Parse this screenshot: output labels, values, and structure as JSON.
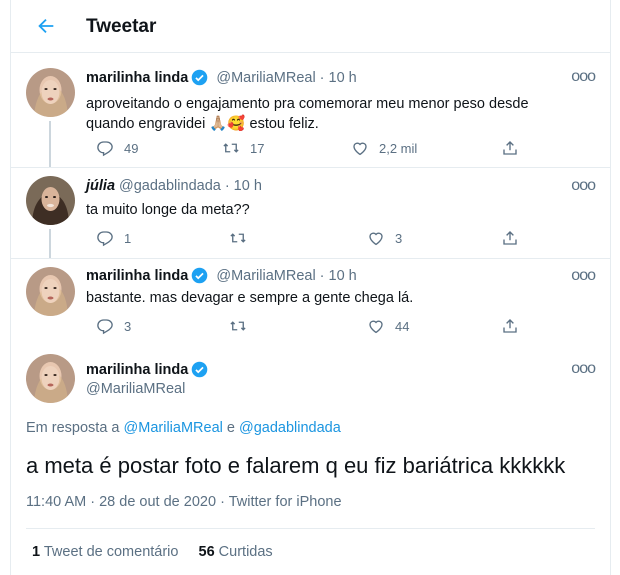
{
  "header": {
    "title": "Tweetar"
  },
  "tweets": [
    {
      "name": "marilinha linda",
      "handle": "@MariliaMReal",
      "time": "10 h",
      "text_line1": "aproveitando o engajamento pra comemorar meu menor peso desde",
      "text_line2_a": "quando engravidei",
      "emoji": "🙏🏼🥰",
      "text_line2_b": "estou feliz.",
      "replies": "49",
      "retweets": "17",
      "likes": "2,2 mil"
    },
    {
      "name": "júlia",
      "handle": "@gadablindada",
      "time": "10 h",
      "text": "ta muito longe da meta??",
      "replies": "1",
      "retweets": "",
      "likes": "3"
    },
    {
      "name": "marilinha linda",
      "handle": "@MariliaMReal",
      "time": "10 h",
      "text": "bastante. mas devagar e sempre a gente chega lá.",
      "replies": "3",
      "retweets": "",
      "likes": "44"
    }
  ],
  "main": {
    "name": "marilinha linda",
    "handle": "@MariliaMReal",
    "reply_prefix": "Em resposta a",
    "reply_user1": "@MariliaMReal",
    "reply_and": "e",
    "reply_user2": "@gadablindada",
    "text": "a meta é postar foto e falarem q eu fiz bariátrica kkkkkk",
    "time": "11:40 AM",
    "date": "28 de out de 2020",
    "source": "Twitter for iPhone",
    "quote_count": "1",
    "quote_label": "Tweet de comentário",
    "like_count": "56",
    "like_label": "Curtidas"
  },
  "more_glyph": "ooo",
  "dot": "·",
  "colors": {
    "accent": "#1da1f2",
    "link": "#1b95e0",
    "muted": "#5b7083"
  }
}
